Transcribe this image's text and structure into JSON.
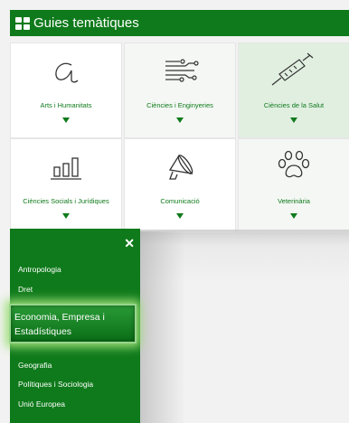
{
  "header": {
    "title": "Guies temàtiques",
    "icon": "grid-icon"
  },
  "tiles": [
    {
      "label": "Arts i Humanitats",
      "icon": "letter-a-icon"
    },
    {
      "label": "Ciències i Enginyeries",
      "icon": "circuit-icon"
    },
    {
      "label": "Ciències de la Salut",
      "icon": "syringe-icon"
    },
    {
      "label": "Ciències Socials i Jurídiques",
      "icon": "bar-chart-icon"
    },
    {
      "label": "Comunicació",
      "icon": "megaphone-icon"
    },
    {
      "label": "Veterinària",
      "icon": "paw-icon"
    }
  ],
  "dropdown": {
    "close": "✕",
    "items": [
      "Antropologia",
      "Dret",
      "Economia, Empresa i Estadístiques",
      "Geografia",
      "Polítiques i Sociologia",
      "Unió Europea"
    ],
    "highlighted_index": 2
  },
  "colors": {
    "brand_green": "#0f7a1b",
    "tile_highlight": "#e1efe1"
  }
}
